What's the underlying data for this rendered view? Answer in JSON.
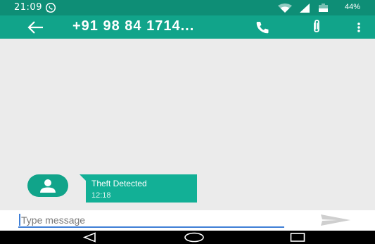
{
  "status_bar": {
    "time": "21:09",
    "battery_text": "44%",
    "icons": [
      "whatsapp-icon",
      "wifi-icon",
      "signal-icon",
      "battery-icon"
    ]
  },
  "toolbar": {
    "title": "+91 98 84 1714...",
    "icons": [
      "back-arrow-icon",
      "phone-icon",
      "attachment-icon",
      "more-vert-icon"
    ],
    "accent_color": "#11a48a"
  },
  "messages": [
    {
      "text": "Theft Detected",
      "time": "12:18",
      "direction": "incoming",
      "bubble_color": "#12b096"
    }
  ],
  "composer": {
    "placeholder": "Type message",
    "value": "",
    "send_icon": "send-icon"
  },
  "nav_bar": {
    "icons": [
      "nav-back-icon",
      "nav-home-icon",
      "nav-recents-icon"
    ]
  }
}
